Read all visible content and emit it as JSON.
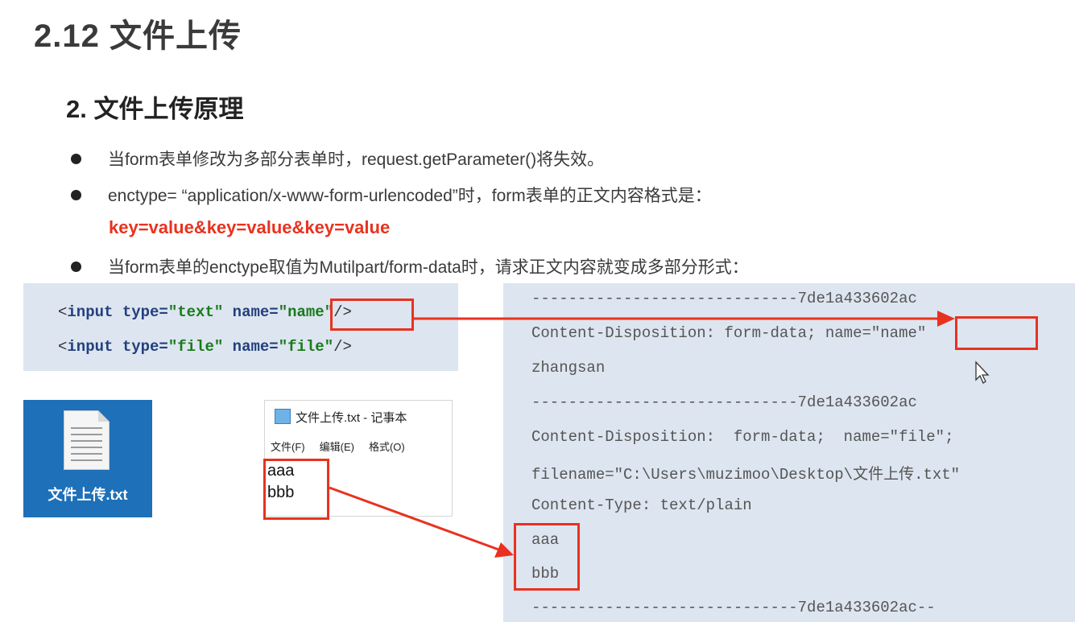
{
  "header": {
    "title": "2.12 文件上传",
    "subtitle": "2. 文件上传原理"
  },
  "bullets": [
    "当form表单修改为多部分表单时，request.getParameter()将失效。",
    "enctype= “application/x-www-form-urlencoded”时，form表单的正文内容格式是：",
    "当form表单的enctype取值为Mutilpart/form-data时，请求正文内容就变成多部分形式："
  ],
  "red_text": "key=value&key=value&key=value",
  "html_code": {
    "line1": {
      "open": "<",
      "tag": "input",
      "attr1": "type=",
      "val1": "\"text\"",
      "attr2": "name=",
      "val2": "\"name\"",
      "close": "/>"
    },
    "line2": {
      "open": "<",
      "tag": "input",
      "attr1": "type=",
      "val1": "\"file\"",
      "attr2": "name=",
      "val2": "\"file\"",
      "close": "/>"
    }
  },
  "desktop_file": {
    "label": "文件上传.txt",
    "icon": "text-file-icon"
  },
  "notepad": {
    "title": "文件上传.txt - 记事本",
    "menu": [
      "文件(F)",
      "编辑(E)",
      "格式(O)"
    ],
    "lines": [
      "aaa",
      "bbb"
    ]
  },
  "request_body": [
    "-----------------------------7de1a433602ac",
    "Content-Disposition: form-data; name=\"name\"",
    "zhangsan",
    "-----------------------------7de1a433602ac",
    "Content-Disposition:  form-data;  name=\"file\";",
    "filename=\"C:\\Users\\muzimoo\\Desktop\\文件上传.txt\"",
    "Content-Type: text/plain",
    "aaa",
    "bbb",
    "-----------------------------7de1a433602ac--"
  ],
  "colors": {
    "highlight": "#e8321f",
    "code_bg": "#dde5f0",
    "icon_bg": "#1e70b8"
  }
}
